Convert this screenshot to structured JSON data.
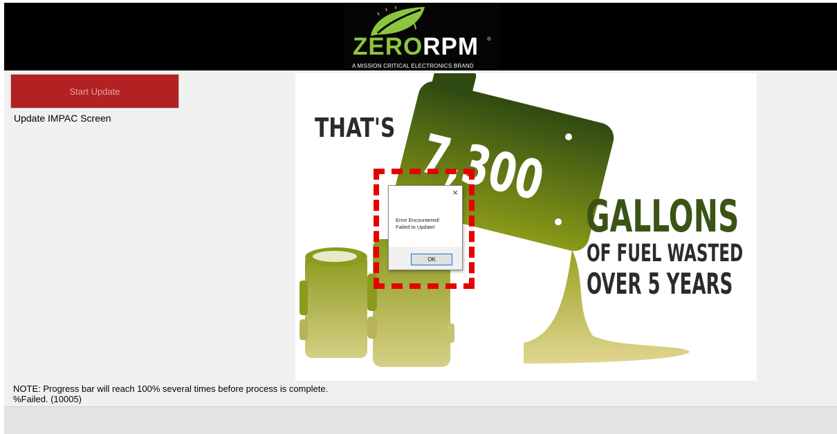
{
  "header": {
    "logo_brand_zero": "ZERO",
    "logo_brand_rpm": "RPM",
    "logo_registered": "®",
    "logo_tagline": "A MISSION CRITICAL ELECTRONICS BRAND"
  },
  "controls": {
    "start_button_label": "Start Update",
    "update_label": "Update IMPAC Screen"
  },
  "hero": {
    "line1": "THAT'S",
    "number": "7,300",
    "line2": "GALLONS",
    "line3": "OF FUEL WASTED",
    "line4": "OVER 5 YEARS"
  },
  "dialog": {
    "close_glyph": "×",
    "message_line1": "Error Encountered!",
    "message_line2": "Failed to Update!",
    "ok_label": "OK"
  },
  "footer": {
    "note": "NOTE: Progress bar will reach 100% several times before process is complete.",
    "status": "%Failed. (10005)"
  },
  "colors": {
    "header_bg": "#000000",
    "start_button": "#b22222",
    "logo_green": "#8cc63f",
    "highlight_red": "#e60000",
    "hero_dark_green": "#3b5315"
  }
}
